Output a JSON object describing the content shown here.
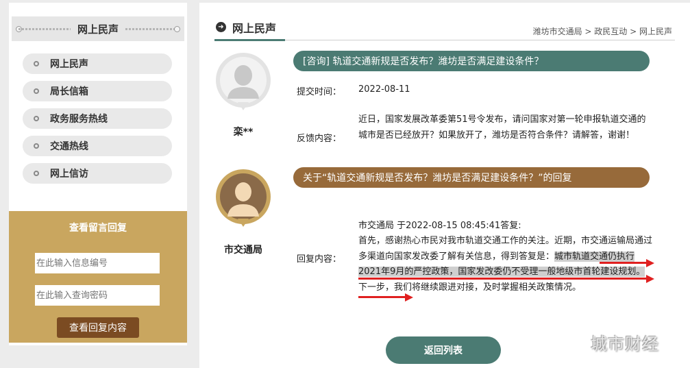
{
  "sidebar": {
    "title": "网上民声",
    "items": [
      {
        "label": "网上民声"
      },
      {
        "label": "局长信箱"
      },
      {
        "label": "政务服务热线"
      },
      {
        "label": "交通热线"
      },
      {
        "label": "网上信访"
      }
    ],
    "query": {
      "title": "查看留言回复",
      "id_placeholder": "在此输入信息编号",
      "password_placeholder": "在此输入查询密码",
      "button_label": "查看回复内容"
    }
  },
  "main": {
    "title": "网上民声",
    "breadcrumb": [
      "潍坊市交通局",
      "政民互动",
      "网上民声"
    ],
    "breadcrumb_sep": " > ",
    "question": {
      "author": "栾**",
      "title": "[咨询] 轨道交通新规是否发布？潍坊是否满足建设条件？",
      "submit_label": "提交时间：",
      "submit_date": "2022-08-11",
      "content_label": "反馈内容：",
      "content": "近日，国家发展改革委第51号令发布，请问国家对第一轮申报轨道交通的城市是否已经放开？如果放开了，潍坊是否符合条件？请解答，谢谢！"
    },
    "reply": {
      "author": "市交通局",
      "title": "关于“轨道交通新规是否发布？潍坊是否满足建设条件？”的回复",
      "meta": "市交通局 于2022-08-15 08:45:41答复:",
      "content_label": "回复内容：",
      "content_before": "首先，感谢热心市民对我市轨道交通工作的关注。近期，市交通运输局通过多渠道向国家发改委了解有关信息，得到答复是：",
      "content_highlight": "城市轨道交通仍执行2021年9月的严控政策，国家发改委仍不受理一般地级市首轮建设规划。",
      "content_after": "下一步，我们将继续跟进对接，及时掌握相关政策情况。"
    },
    "back_button": "返回列表"
  },
  "watermark": "城市财经",
  "colors": {
    "accent_green": "#4b7b73",
    "accent_brown": "#976a3a",
    "sidebar_gold": "#c9a65f",
    "button_brown": "#7b4b22",
    "annotation_red": "#e02020"
  }
}
